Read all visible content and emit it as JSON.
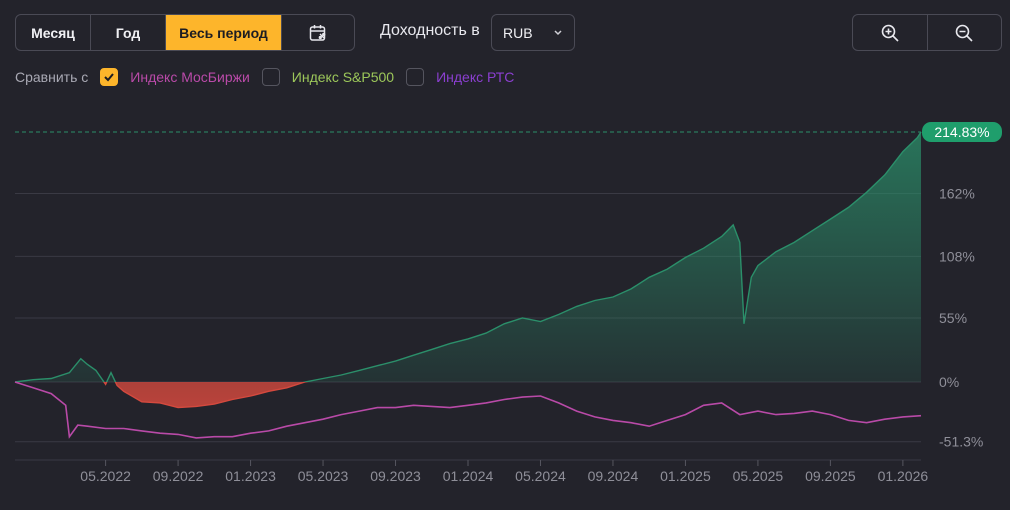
{
  "period_buttons": [
    "Месяц",
    "Год",
    "Весь период"
  ],
  "active_period": "Весь период",
  "yield_label": "Доходность в",
  "currency": {
    "selected": "RUB"
  },
  "compare": {
    "label": "Сравнить с",
    "items": [
      {
        "label": "Индекс МосБиржи",
        "checked": true,
        "color": "#b94aa8"
      },
      {
        "label": "Индекс S&P500",
        "checked": false,
        "color": "#9cc75a"
      },
      {
        "label": "Индекс РТС",
        "checked": false,
        "color": "#8b3fd0"
      }
    ]
  },
  "colors": {
    "accent": "#fdb52b",
    "portfolio": "#2b8f6a",
    "badge": "#1f9e6c",
    "negative": "#d4493e",
    "index": "#b94aa8"
  },
  "chart_data": {
    "type": "area",
    "current_label": "214.83%",
    "y_ticks": [
      "162%",
      "108%",
      "55%",
      "0%",
      "-51.3%"
    ],
    "y_tick_values": [
      162,
      108,
      55,
      0,
      -51.3
    ],
    "x_ticks": [
      "05.2022",
      "09.2022",
      "01.2023",
      "05.2023",
      "09.2023",
      "01.2024",
      "05.2024",
      "09.2024",
      "01.2025",
      "05.2025",
      "09.2025",
      "01.2026"
    ],
    "ylim": [
      -68,
      214.83
    ],
    "x_range": [
      "2021-12",
      "2026-02"
    ],
    "series": [
      {
        "points": [
          [
            "2021-12-01",
            0
          ],
          [
            "2022-01-01",
            2
          ],
          [
            "2022-02-01",
            3
          ],
          [
            "2022-03-01",
            8
          ],
          [
            "2022-03-20",
            20
          ],
          [
            "2022-04-01",
            15
          ],
          [
            "2022-04-15",
            10
          ],
          [
            "2022-05-01",
            -2
          ],
          [
            "2022-05-10",
            8
          ],
          [
            "2022-05-20",
            -3
          ],
          [
            "2022-06-01",
            -8
          ],
          [
            "2022-07-01",
            -17
          ],
          [
            "2022-08-01",
            -18
          ],
          [
            "2022-09-01",
            -22
          ],
          [
            "2022-10-01",
            -21
          ],
          [
            "2022-11-01",
            -19
          ],
          [
            "2022-12-01",
            -15
          ],
          [
            "2023-01-01",
            -12
          ],
          [
            "2023-02-01",
            -8
          ],
          [
            "2023-03-01",
            -5
          ],
          [
            "2023-04-01",
            0
          ],
          [
            "2023-05-01",
            3
          ],
          [
            "2023-06-01",
            6
          ],
          [
            "2023-07-01",
            10
          ],
          [
            "2023-08-01",
            14
          ],
          [
            "2023-09-01",
            18
          ],
          [
            "2023-10-01",
            23
          ],
          [
            "2023-11-01",
            28
          ],
          [
            "2023-12-01",
            33
          ],
          [
            "2024-01-01",
            37
          ],
          [
            "2024-02-01",
            42
          ],
          [
            "2024-03-01",
            50
          ],
          [
            "2024-04-01",
            55
          ],
          [
            "2024-05-01",
            52
          ],
          [
            "2024-06-01",
            58
          ],
          [
            "2024-07-01",
            65
          ],
          [
            "2024-08-01",
            70
          ],
          [
            "2024-09-01",
            73
          ],
          [
            "2024-10-01",
            80
          ],
          [
            "2024-11-01",
            90
          ],
          [
            "2024-12-01",
            97
          ],
          [
            "2025-01-01",
            107
          ],
          [
            "2025-02-01",
            115
          ],
          [
            "2025-03-01",
            125
          ],
          [
            "2025-03-20",
            135
          ],
          [
            "2025-04-01",
            120
          ],
          [
            "2025-04-08",
            50
          ],
          [
            "2025-04-20",
            90
          ],
          [
            "2025-05-01",
            100
          ],
          [
            "2025-06-01",
            112
          ],
          [
            "2025-07-01",
            120
          ],
          [
            "2025-08-01",
            130
          ],
          [
            "2025-09-01",
            140
          ],
          [
            "2025-10-01",
            150
          ],
          [
            "2025-11-01",
            163
          ],
          [
            "2025-12-01",
            178
          ],
          [
            "2026-01-01",
            198
          ],
          [
            "2026-01-25",
            210
          ],
          [
            "2026-02-01",
            214.83
          ]
        ]
      },
      {
        "points": [
          [
            "2021-12-01",
            0
          ],
          [
            "2022-01-01",
            -5
          ],
          [
            "2022-02-01",
            -10
          ],
          [
            "2022-02-25",
            -20
          ],
          [
            "2022-03-01",
            -47
          ],
          [
            "2022-03-15",
            -37
          ],
          [
            "2022-04-01",
            -38
          ],
          [
            "2022-05-01",
            -40
          ],
          [
            "2022-06-01",
            -40
          ],
          [
            "2022-07-01",
            -42
          ],
          [
            "2022-08-01",
            -44
          ],
          [
            "2022-09-01",
            -45
          ],
          [
            "2022-10-01",
            -48
          ],
          [
            "2022-11-01",
            -47
          ],
          [
            "2022-12-01",
            -47
          ],
          [
            "2023-01-01",
            -44
          ],
          [
            "2023-02-01",
            -42
          ],
          [
            "2023-03-01",
            -38
          ],
          [
            "2023-04-01",
            -35
          ],
          [
            "2023-05-01",
            -32
          ],
          [
            "2023-06-01",
            -28
          ],
          [
            "2023-07-01",
            -25
          ],
          [
            "2023-08-01",
            -22
          ],
          [
            "2023-09-01",
            -22
          ],
          [
            "2023-10-01",
            -20
          ],
          [
            "2023-11-01",
            -21
          ],
          [
            "2023-12-01",
            -22
          ],
          [
            "2024-01-01",
            -20
          ],
          [
            "2024-02-01",
            -18
          ],
          [
            "2024-03-01",
            -15
          ],
          [
            "2024-04-01",
            -13
          ],
          [
            "2024-05-01",
            -12
          ],
          [
            "2024-06-01",
            -18
          ],
          [
            "2024-07-01",
            -25
          ],
          [
            "2024-08-01",
            -30
          ],
          [
            "2024-09-01",
            -33
          ],
          [
            "2024-10-01",
            -35
          ],
          [
            "2024-11-01",
            -38
          ],
          [
            "2024-12-01",
            -33
          ],
          [
            "2025-01-01",
            -28
          ],
          [
            "2025-02-01",
            -20
          ],
          [
            "2025-03-01",
            -18
          ],
          [
            "2025-04-01",
            -28
          ],
          [
            "2025-05-01",
            -25
          ],
          [
            "2025-06-01",
            -28
          ],
          [
            "2025-07-01",
            -27
          ],
          [
            "2025-08-01",
            -25
          ],
          [
            "2025-09-01",
            -28
          ],
          [
            "2025-10-01",
            -33
          ],
          [
            "2025-11-01",
            -35
          ],
          [
            "2025-12-01",
            -32
          ],
          [
            "2026-01-01",
            -30
          ],
          [
            "2026-02-01",
            -29
          ]
        ]
      }
    ]
  }
}
